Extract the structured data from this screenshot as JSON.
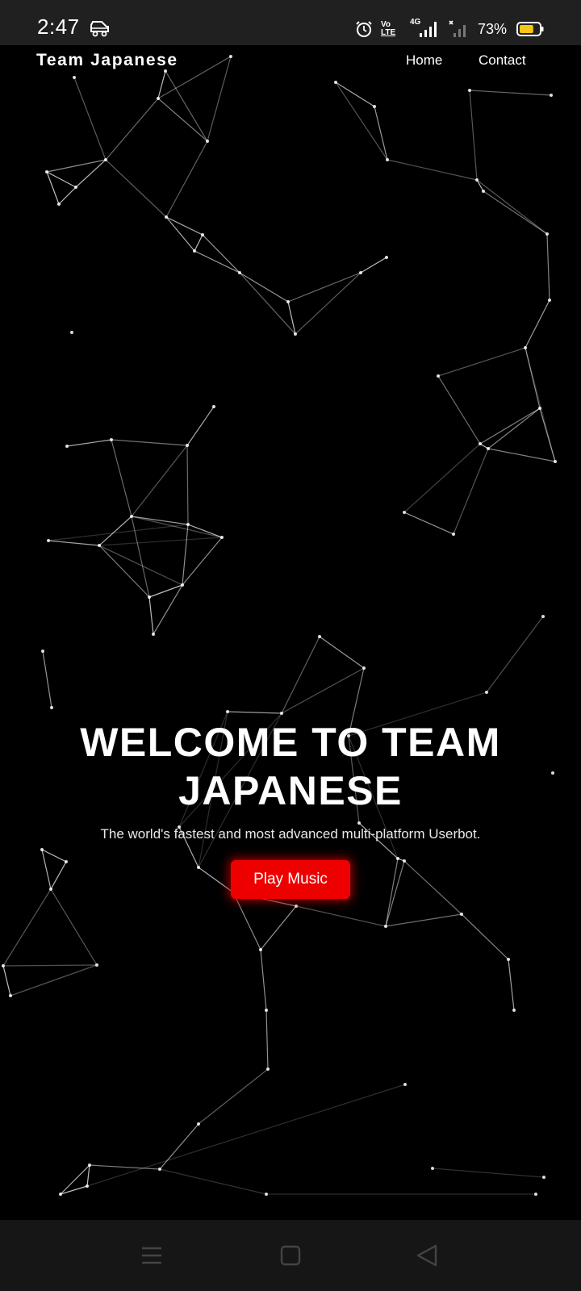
{
  "status_bar": {
    "time": "2:47",
    "notification_icon": "incognito-vehicle-icon",
    "alarm_icon": "alarm-icon",
    "volte_label_top": "Vo",
    "volte_label_bottom": "LTE",
    "network_label": "4G",
    "battery_percent": "73%",
    "battery_level": 0.73,
    "battery_color": "#f5c518"
  },
  "navbar": {
    "brand": "Team Japanese",
    "links": [
      {
        "label": "Home"
      },
      {
        "label": "Contact"
      }
    ]
  },
  "hero": {
    "title": "WELCOME TO TEAM JAPANESE",
    "subtitle": "The world's fastest and most advanced multi-platform Userbot.",
    "button_label": "Play Music",
    "button_color": "#ee0000"
  },
  "background": {
    "type": "particle-network",
    "color": "#000000",
    "line_color": "#ffffff"
  },
  "system_nav": {
    "menu_icon": "menu-icon",
    "home_icon": "home-square-icon",
    "back_icon": "back-triangle-icon"
  }
}
